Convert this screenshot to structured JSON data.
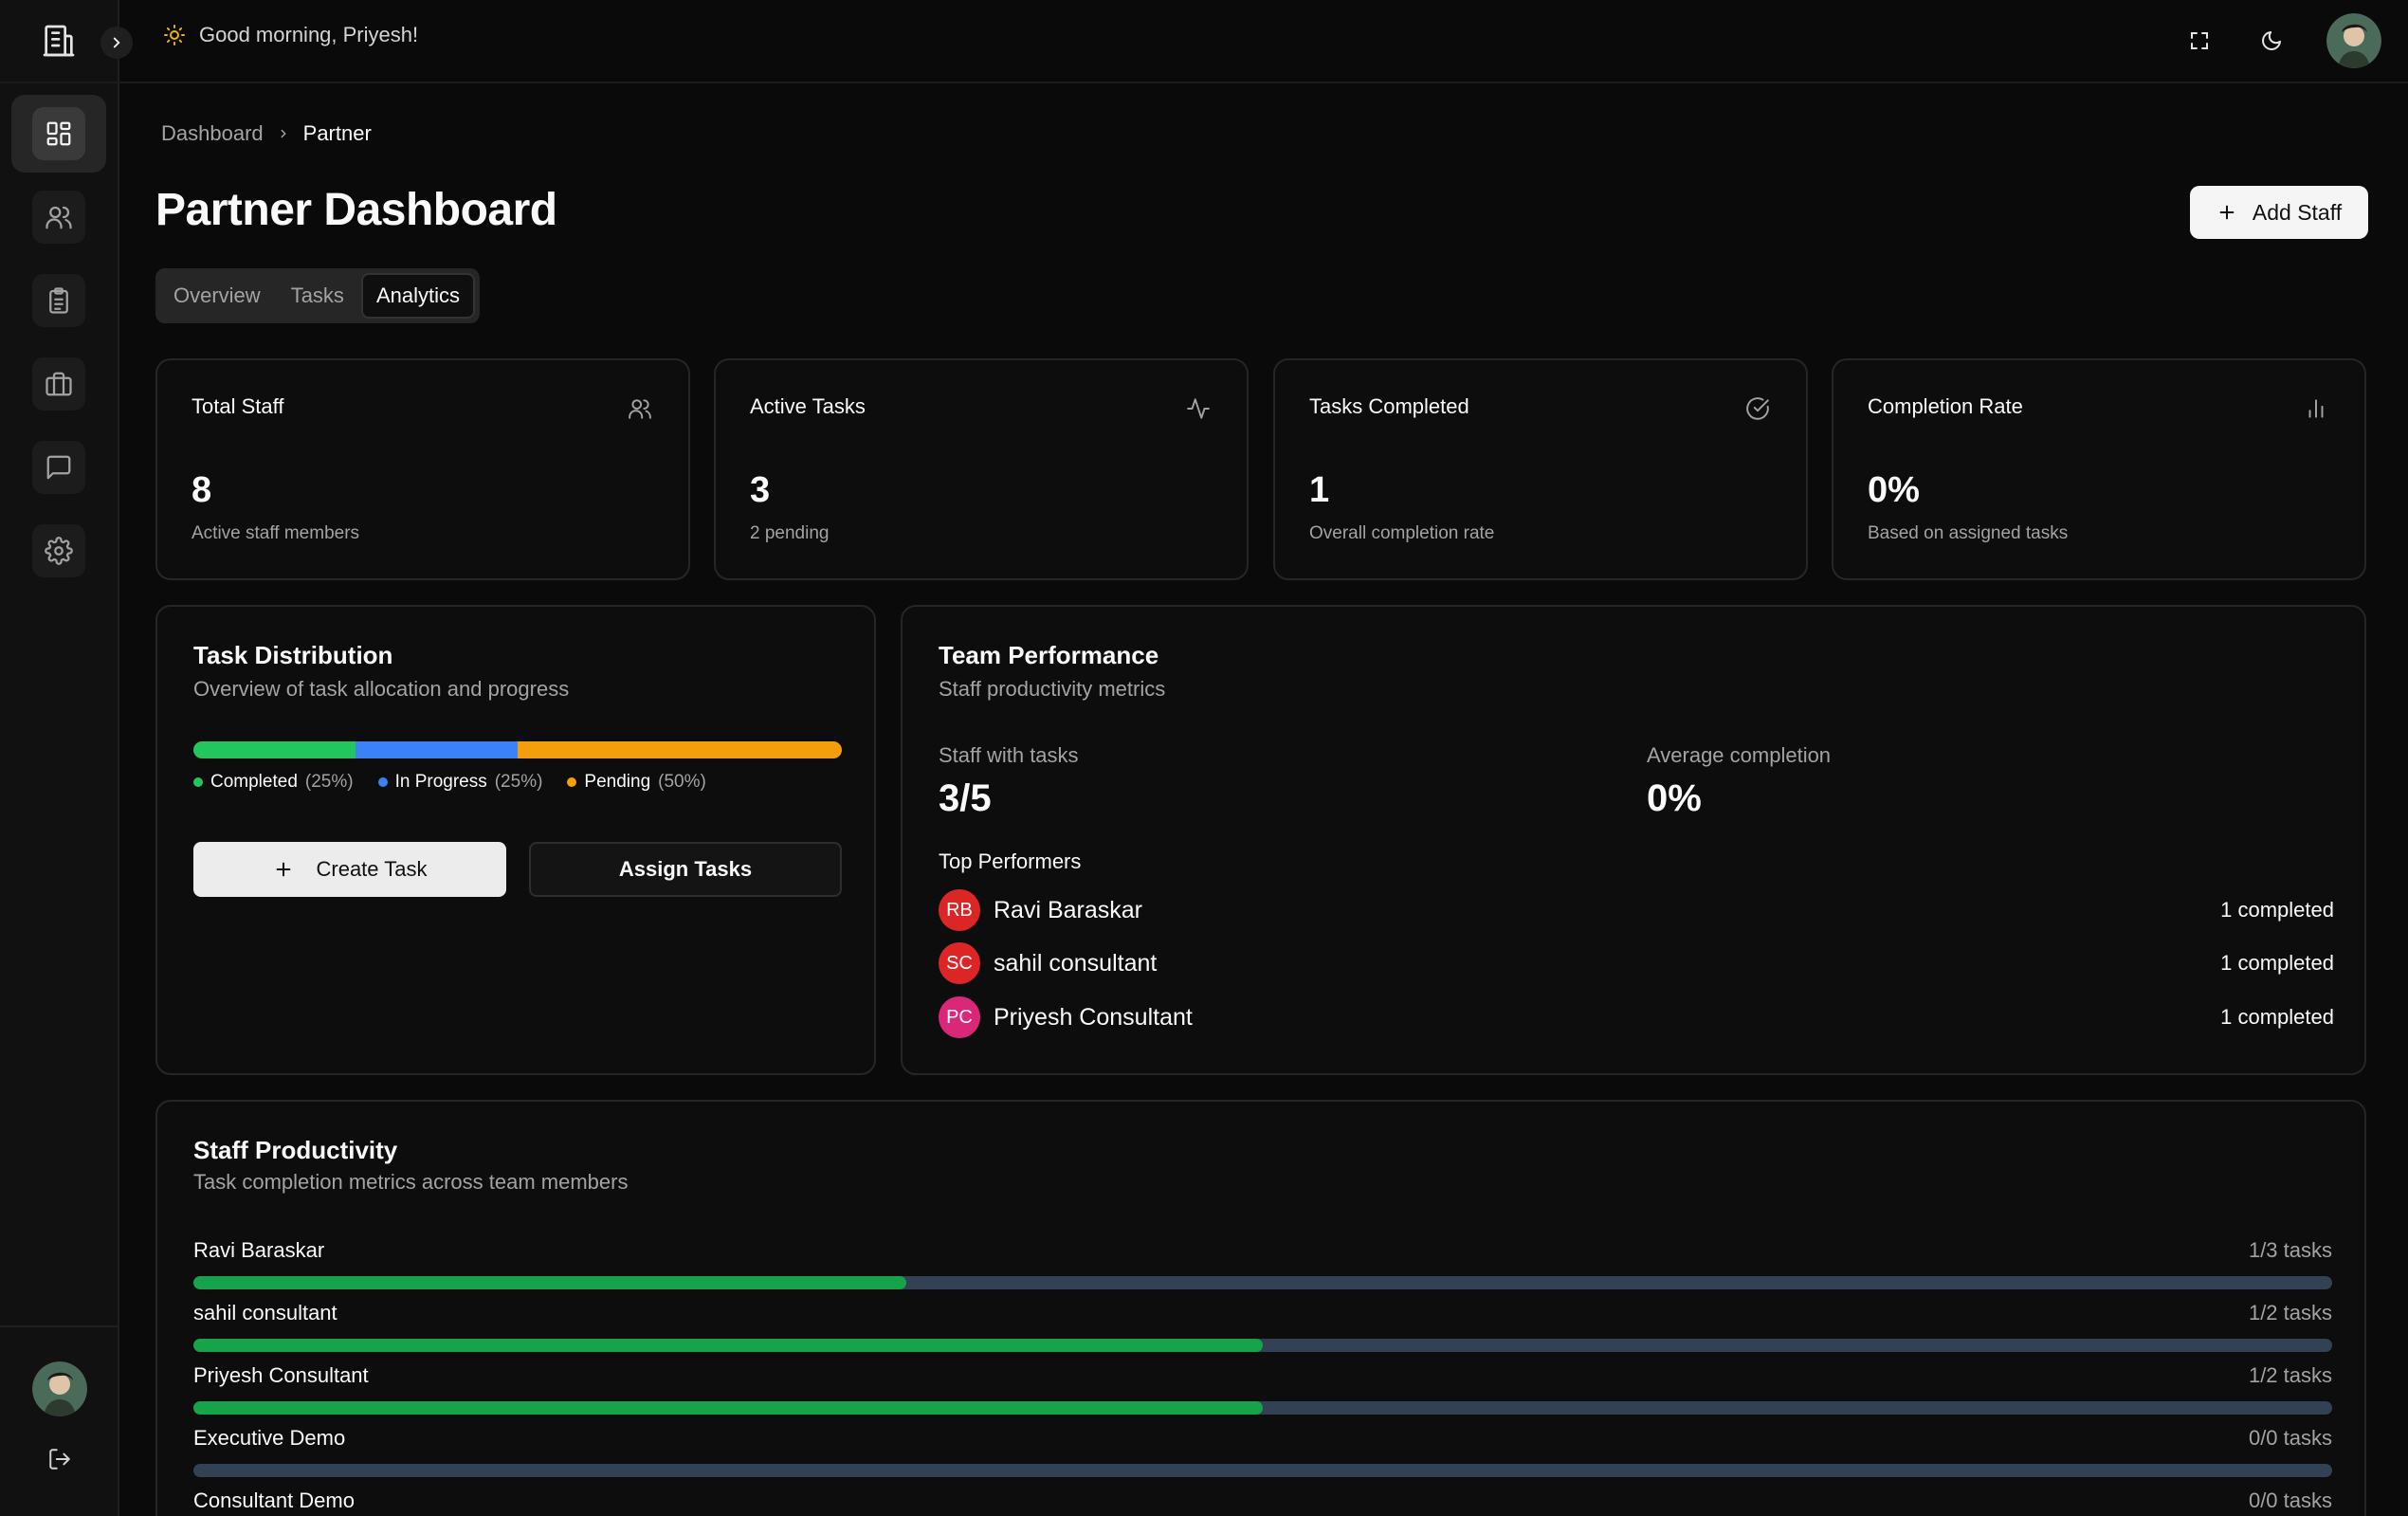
{
  "topbar": {
    "greeting": "Good morning, Priyesh!",
    "icons": [
      "fullscreen-icon",
      "moon-icon"
    ]
  },
  "sidebar": {
    "items": [
      {
        "name": "dashboard",
        "icon": "layout-grid-icon",
        "active": true
      },
      {
        "name": "users",
        "icon": "users-icon",
        "active": false
      },
      {
        "name": "tasks",
        "icon": "clipboard-list-icon",
        "active": false
      },
      {
        "name": "briefcase",
        "icon": "briefcase-icon",
        "active": false
      },
      {
        "name": "messages",
        "icon": "message-square-icon",
        "active": false
      },
      {
        "name": "settings",
        "icon": "gear-icon",
        "active": false
      }
    ]
  },
  "breadcrumb": {
    "root": "Dashboard",
    "current": "Partner"
  },
  "page": {
    "title": "Partner Dashboard",
    "add_staff_label": "Add Staff"
  },
  "tabs": [
    {
      "label": "Overview",
      "active": false
    },
    {
      "label": "Tasks",
      "active": false
    },
    {
      "label": "Analytics",
      "active": true
    }
  ],
  "stats": [
    {
      "title": "Total Staff",
      "value": "8",
      "sub": "Active staff members",
      "icon": "users-icon"
    },
    {
      "title": "Active Tasks",
      "value": "3",
      "sub": "2 pending",
      "icon": "activity-icon"
    },
    {
      "title": "Tasks Completed",
      "value": "1",
      "sub": "Overall completion rate",
      "icon": "check-circle-icon"
    },
    {
      "title": "Completion Rate",
      "value": "0%",
      "sub": "Based on assigned tasks",
      "icon": "bar-chart-icon"
    }
  ],
  "task_distribution": {
    "title": "Task Distribution",
    "subtitle": "Overview of task allocation and progress",
    "segments": [
      {
        "label": "Completed",
        "pct_label": "(25%)",
        "pct": 25,
        "color": "#22c55e"
      },
      {
        "label": "In Progress",
        "pct_label": "(25%)",
        "pct": 25,
        "color": "#3b82f6"
      },
      {
        "label": "Pending",
        "pct_label": "(50%)",
        "pct": 50,
        "color": "#f59e0b"
      }
    ],
    "create_label": "Create Task",
    "assign_label": "Assign Tasks"
  },
  "team_performance": {
    "title": "Team Performance",
    "subtitle": "Staff productivity metrics",
    "staff_with_tasks_label": "Staff with tasks",
    "staff_with_tasks_value": "3/5",
    "avg_completion_label": "Average completion",
    "avg_completion_value": "0%",
    "top_performers_label": "Top Performers",
    "performers": [
      {
        "initials": "RB",
        "name": "Ravi Baraskar",
        "count": "1 completed",
        "color": "#dc2626"
      },
      {
        "initials": "SC",
        "name": "sahil consultant",
        "count": "1 completed",
        "color": "#dc2626"
      },
      {
        "initials": "PC",
        "name": "Priyesh Consultant",
        "count": "1 completed",
        "color": "#db2777"
      }
    ]
  },
  "staff_productivity": {
    "title": "Staff Productivity",
    "subtitle": "Task completion metrics across team members",
    "rows": [
      {
        "name": "Ravi Baraskar",
        "count": "1/3 tasks",
        "fraction": 0.3333
      },
      {
        "name": "sahil consultant",
        "count": "1/2 tasks",
        "fraction": 0.5
      },
      {
        "name": "Priyesh Consultant",
        "count": "1/2 tasks",
        "fraction": 0.5
      },
      {
        "name": "Executive Demo",
        "count": "0/0 tasks",
        "fraction": 0
      },
      {
        "name": "Consultant Demo",
        "count": "0/0 tasks",
        "fraction": 0
      }
    ]
  },
  "colors": {
    "background": "#0a0a0a",
    "card": "#0d0d0d",
    "border": "#262626",
    "progress": "#16a34a",
    "track": "#334155"
  }
}
